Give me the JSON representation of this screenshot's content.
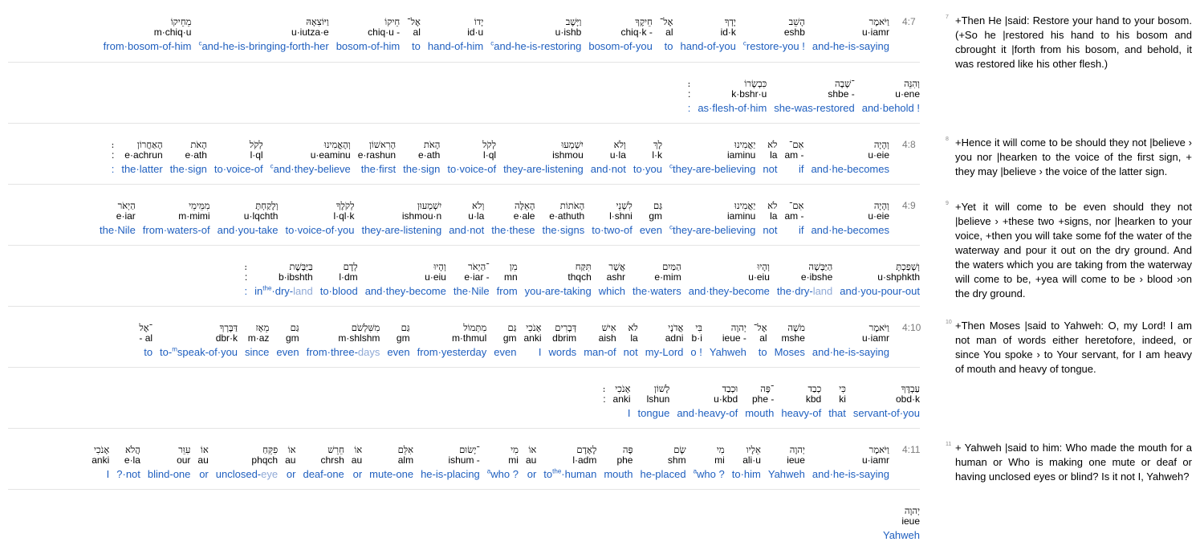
{
  "rows": [
    {
      "ref": "4:7",
      "words": [
        {
          "heb": "וַיֹּאמֶר",
          "tr": "u·iamr",
          "gl": "and-he-is-saying"
        },
        {
          "heb": "הָשֵׁב",
          "tr": "eshb",
          "gl": "restore-you !",
          "pre": "c"
        },
        {
          "heb": "יָדְךָ",
          "tr": "id·k",
          "gl": "hand-of-you"
        },
        {
          "heb": "אֶל־",
          "tr": "al",
          "gl": "to"
        },
        {
          "heb": "חֵיקֶךָ",
          "tr": "chiq·k -",
          "gl": "bosom-of-you"
        },
        {
          "heb": "וַיָּשֶׁב",
          "tr": "u·ishb",
          "gl": "and-he-is-restoring",
          "pre": "c"
        },
        {
          "heb": "יָדוֹ",
          "tr": "id·u",
          "gl": "hand-of-him"
        },
        {
          "heb": "אֶל־",
          "tr": "al",
          "gl": "to"
        },
        {
          "heb": "חֵיקוֹ",
          "tr": "chiq·u -",
          "gl": "bosom-of-him"
        },
        {
          "heb": "וַיּוֹצִאָהּ",
          "tr": "u·iutza·e",
          "gl": "and-he-is-bringing-forth-her",
          "pre": "c"
        },
        {
          "heb": "מֵחֵיקוֹ",
          "tr": "m·chiq·u",
          "gl": "from·bosom-of-him"
        }
      ]
    },
    {
      "ref": "",
      "words": [
        {
          "heb": "וְהִנֵּה",
          "tr": "u·ene",
          "gl": "and·behold !"
        },
        {
          "heb": "־שָׁבָה",
          "tr": "shbe -",
          "gl": "she-was-restored"
        },
        {
          "heb": "כִּבְשָׂרוֹ",
          "tr": "k·bshr·u",
          "gl": "as·flesh-of·him"
        },
        {
          "heb": ":",
          "tr": ":",
          "gl": ":"
        }
      ]
    },
    {
      "ref": "4:8",
      "words": [
        {
          "heb": "וְהָיָה",
          "tr": "u·eie",
          "gl": "and·he-becomes"
        },
        {
          "heb": "אִם־",
          "tr": "am -",
          "gl": "if"
        },
        {
          "heb": "לֹא",
          "tr": "la",
          "gl": "not"
        },
        {
          "heb": "יַאֲמִינוּ",
          "tr": "iaminu",
          "gl": "they-are-believing",
          "pre": "c"
        },
        {
          "heb": "לָךְ",
          "tr": "l·k",
          "gl": "to·you"
        },
        {
          "heb": "וְלֹא",
          "tr": "u·la",
          "gl": "and·not"
        },
        {
          "heb": "יִשְׁמְעוּ",
          "tr": "ishmou",
          "gl": "they-are-listening"
        },
        {
          "heb": "לְקֹל",
          "tr": "l·ql",
          "gl": "to·voice-of"
        },
        {
          "heb": "הָאֹת",
          "tr": "e·ath",
          "gl": "the·sign"
        },
        {
          "heb": "הָרִאשׁוֹן",
          "tr": "e·rashun",
          "gl": "the·first"
        },
        {
          "heb": "וְהֶאֱמִינוּ",
          "tr": "u·eaminu",
          "gl": "and·they-believe",
          "pre": "c"
        },
        {
          "heb": "לְקֹל",
          "tr": "l·ql",
          "gl": "to·voice-of"
        },
        {
          "heb": "הָאֹת",
          "tr": "e·ath",
          "gl": "the·sign"
        },
        {
          "heb": "הָאַחֲרוֹן",
          "tr": "e·achrun",
          "gl": "the·latter"
        },
        {
          "heb": ":",
          "tr": ":",
          "gl": ":"
        }
      ]
    },
    {
      "ref": "4:9",
      "words": [
        {
          "heb": "וְהָיָה",
          "tr": "u·eie",
          "gl": "and·he-becomes"
        },
        {
          "heb": "אִם־",
          "tr": "am -",
          "gl": "if"
        },
        {
          "heb": "לֹא",
          "tr": "la",
          "gl": "not"
        },
        {
          "heb": "יַאֲמִינוּ",
          "tr": "iaminu",
          "gl": "they-are-believing",
          "pre": "c"
        },
        {
          "heb": "גַּם",
          "tr": "gm",
          "gl": "even"
        },
        {
          "heb": "לִשְׁנֵי",
          "tr": "l·shni",
          "gl": "to·two-of"
        },
        {
          "heb": "הָאֹתוֹת",
          "tr": "e·athuth",
          "gl": "the·signs"
        },
        {
          "heb": "הָאֵלֶּה",
          "tr": "e·ale",
          "gl": "the·these"
        },
        {
          "heb": "וְלֹא",
          "tr": "u·la",
          "gl": "and·not"
        },
        {
          "heb": "יִשְׁמְעוּן",
          "tr": "ishmou·n",
          "gl": "they-are-listening"
        },
        {
          "heb": "לְקֹלֶךָ",
          "tr": "l·ql·k",
          "gl": "to·voice-of·you"
        },
        {
          "heb": "וְלָקַחְתָּ",
          "tr": "u·lqchth",
          "gl": "and·you-take"
        },
        {
          "heb": "מִמֵּימֵי",
          "tr": "m·mimi",
          "gl": "from·waters-of"
        },
        {
          "heb": "הַיְאֹר",
          "tr": "e·iar",
          "gl": "the·Nile"
        }
      ]
    },
    {
      "ref": "",
      "words": [
        {
          "heb": "וְשָׁפַכְתָּ",
          "tr": "u·shphkth",
          "gl": "and·you-pour-out"
        },
        {
          "heb": "הַיַּבָּשָׁה",
          "tr": "e·ibshe",
          "gl": "the·dry-land",
          "dim": "land"
        },
        {
          "heb": "וְהָיוּ",
          "tr": "u·eiu",
          "gl": "and·they-become"
        },
        {
          "heb": "הַמַּיִם",
          "tr": "e·mim",
          "gl": "the·waters"
        },
        {
          "heb": "אֲשֶׁר",
          "tr": "ashr",
          "gl": "which"
        },
        {
          "heb": "תִּקַּח",
          "tr": "thqch",
          "gl": "you-are-taking"
        },
        {
          "heb": "מִן",
          "tr": "mn",
          "gl": "from"
        },
        {
          "heb": "־הַיְאֹר",
          "tr": "e·iar -",
          "gl": "the·Nile"
        },
        {
          "heb": "וְהָיוּ",
          "tr": "u·eiu",
          "gl": "and·they-become"
        },
        {
          "heb": "לְדָם",
          "tr": "l·dm",
          "gl": "to·blood"
        },
        {
          "heb": "בַּיַּבָּשֶׁת",
          "tr": "b·ibshth",
          "gl": "in·the·dry-land",
          "dim": "land",
          "sup": "the"
        },
        {
          "heb": ":",
          "tr": ":",
          "gl": ":"
        }
      ]
    },
    {
      "ref": "4:10",
      "words": [
        {
          "heb": "וַיֹּאמֶר",
          "tr": "u·iamr",
          "gl": "and·he-is-saying"
        },
        {
          "heb": "מֹשֶׁה",
          "tr": "mshe",
          "gl": "Moses"
        },
        {
          "heb": "אֶל־",
          "tr": "al",
          "gl": "to"
        },
        {
          "heb": "יְהוָה",
          "tr": "ieue -",
          "gl": "Yahweh"
        },
        {
          "heb": "בִּי",
          "tr": "b·i",
          "gl": "o !"
        },
        {
          "heb": "אֲדֹנָי",
          "tr": "adni",
          "gl": "my-Lord"
        },
        {
          "heb": "לֹא",
          "tr": "la",
          "gl": "not"
        },
        {
          "heb": "אִישׁ",
          "tr": "aish",
          "gl": "man-of"
        },
        {
          "heb": "דְּבָרִים",
          "tr": "dbrim",
          "gl": "words"
        },
        {
          "heb": "אָנֹכִי",
          "tr": "anki",
          "gl": "I"
        },
        {
          "heb": "גַּם",
          "tr": "gm",
          "gl": "even"
        },
        {
          "heb": "מִתְּמוֹל",
          "tr": "m·thmul",
          "gl": "from·yesterday"
        },
        {
          "heb": "גַּם",
          "tr": "gm",
          "gl": "even"
        },
        {
          "heb": "מִשִּׁלְשֹׁם",
          "tr": "m·shlshm",
          "gl": "from·three-days",
          "dim": "days"
        },
        {
          "heb": "גַּם",
          "tr": "gm",
          "gl": "even"
        },
        {
          "heb": "מֵאָז",
          "tr": "m·az",
          "gl": "since"
        },
        {
          "heb": "דַּבֶּרְךָ",
          "tr": "dbr·k",
          "gl": "to-speak-of·you",
          "sup": "m"
        },
        {
          "heb": "־אֶל",
          "tr": "- al",
          "gl": "to"
        }
      ]
    },
    {
      "ref": "",
      "words": [
        {
          "heb": "עַבְדֶּךָ",
          "tr": "obd·k",
          "gl": "servant-of·you"
        },
        {
          "heb": "כִּי",
          "tr": "ki",
          "gl": "that"
        },
        {
          "heb": "כְבַד",
          "tr": "kbd",
          "gl": "heavy-of"
        },
        {
          "heb": "־פֶּה",
          "tr": "phe -",
          "gl": "mouth"
        },
        {
          "heb": "וּכְבַד",
          "tr": "u·kbd",
          "gl": "and·heavy-of"
        },
        {
          "heb": "לָשׁוֹן",
          "tr": "lshun",
          "gl": "tongue"
        },
        {
          "heb": "אָנֹכִי",
          "tr": "anki",
          "gl": "I"
        },
        {
          "heb": ":",
          "tr": ":",
          "gl": ""
        }
      ]
    },
    {
      "ref": "4:11",
      "words": [
        {
          "heb": "וַיֹּאמֶר",
          "tr": "u·iamr",
          "gl": "and·he-is-saying"
        },
        {
          "heb": "יְהוָה",
          "tr": "ieue",
          "gl": "Yahweh"
        },
        {
          "heb": "אֵלָיו",
          "tr": "ali·u",
          "gl": "to·him"
        },
        {
          "heb": "מִי",
          "tr": "mi",
          "gl": "who ?",
          "pre": "a"
        },
        {
          "heb": "שָׂם",
          "tr": "shm",
          "gl": "he-placed"
        },
        {
          "heb": "פֶּה",
          "tr": "phe",
          "gl": "mouth"
        },
        {
          "heb": "לָאָדָם",
          "tr": "l·adm",
          "gl": "to·the·human",
          "sup": "the"
        },
        {
          "heb": "אוֹ",
          "tr": "au",
          "gl": "or"
        },
        {
          "heb": "מִי",
          "tr": "mi",
          "gl": "who ?",
          "pre": "a"
        },
        {
          "heb": "־יָשׂוּם",
          "tr": "ishum -",
          "gl": "he-is-placing"
        },
        {
          "heb": "אִלֵּם",
          "tr": "alm",
          "gl": "mute-one"
        },
        {
          "heb": "אוֹ",
          "tr": "au",
          "gl": "or"
        },
        {
          "heb": "חֵרֵשׁ",
          "tr": "chrsh",
          "gl": "deaf-one"
        },
        {
          "heb": "אוֹ",
          "tr": "au",
          "gl": "or"
        },
        {
          "heb": "פִקֵּחַ",
          "tr": "phqch",
          "gl": "unclosed-eye",
          "dim": "eye"
        },
        {
          "heb": "אוֹ",
          "tr": "au",
          "gl": "or"
        },
        {
          "heb": "עִוֵּר",
          "tr": "our",
          "gl": "blind-one"
        },
        {
          "heb": "הֲלֹא",
          "tr": "e·la",
          "gl": "?·not"
        },
        {
          "heb": "אָנֹכִי",
          "tr": "anki",
          "gl": "I"
        }
      ]
    },
    {
      "ref": "",
      "words": [
        {
          "heb": "יְהוָה",
          "tr": "ieue",
          "gl": "Yahweh"
        }
      ]
    }
  ],
  "verses": [
    {
      "num": "7",
      "text": "+Then He |said: Restore your hand to your bosom. (+So he |restored his hand to his bosom and cbrought it |forth from his bosom, and behold, it was restored like his other flesh.)"
    },
    {
      "num": "8",
      "text": "+Hence it will come to be should they not |believe › you nor |hearken to the voice of the first sign, + they may |believe › the voice of the latter sign."
    },
    {
      "num": "9",
      "text": "+Yet it will come to be even should they not |believe › +these two +signs, nor |hearken to your voice, +then you will take some fof the water of the waterway and pour it out on the dry ground. And the waters which you are taking from the waterway will come to be, +yea will come to be › blood ›on the dry ground."
    },
    {
      "num": "10",
      "text": "+Then Moses |said to Yahweh: O, my Lord! I am not man of words either heretofore, indeed, or since You spoke › to Your servant, for I am heavy of mouth and heavy of tongue."
    },
    {
      "num": "11",
      "text": "+ Yahweh |said to him: Who made the mouth for a human or Who is making one mute or deaf or having unclosed eyes or blind? Is it not I, Yahweh?"
    }
  ]
}
